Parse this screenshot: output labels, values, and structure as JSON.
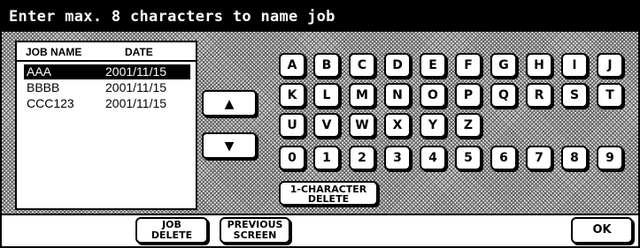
{
  "title": "Enter max. 8 characters to name job",
  "job_list": {
    "headers": {
      "name": "JOB NAME",
      "date": "DATE"
    },
    "rows": [
      {
        "name": "AAA",
        "date": "2001/11/15",
        "selected": true
      },
      {
        "name": "BBBB",
        "date": "2001/11/15",
        "selected": false
      },
      {
        "name": "CCC123",
        "date": "2001/11/15",
        "selected": false
      }
    ]
  },
  "scroll": {
    "up_icon": "triangle-up-icon",
    "down_icon": "triangle-down-icon",
    "up_glyph": "▲",
    "down_glyph": "▼"
  },
  "keyboard": {
    "row1": [
      "A",
      "B",
      "C",
      "D",
      "E",
      "F",
      "G",
      "H",
      "I",
      "J"
    ],
    "row2": [
      "K",
      "L",
      "M",
      "N",
      "O",
      "P",
      "Q",
      "R",
      "S",
      "T"
    ],
    "row3": [
      "U",
      "V",
      "W",
      "X",
      "Y",
      "Z"
    ],
    "row4": [
      "0",
      "1",
      "2",
      "3",
      "4",
      "5",
      "6",
      "7",
      "8",
      "9"
    ],
    "delete_line1": "1-CHARACTER",
    "delete_line2": "DELETE"
  },
  "bottom": {
    "job_delete_line1": "JOB",
    "job_delete_line2": "DELETE",
    "previous_line1": "PREVIOUS",
    "previous_line2": "SCREEN",
    "ok": "OK"
  }
}
